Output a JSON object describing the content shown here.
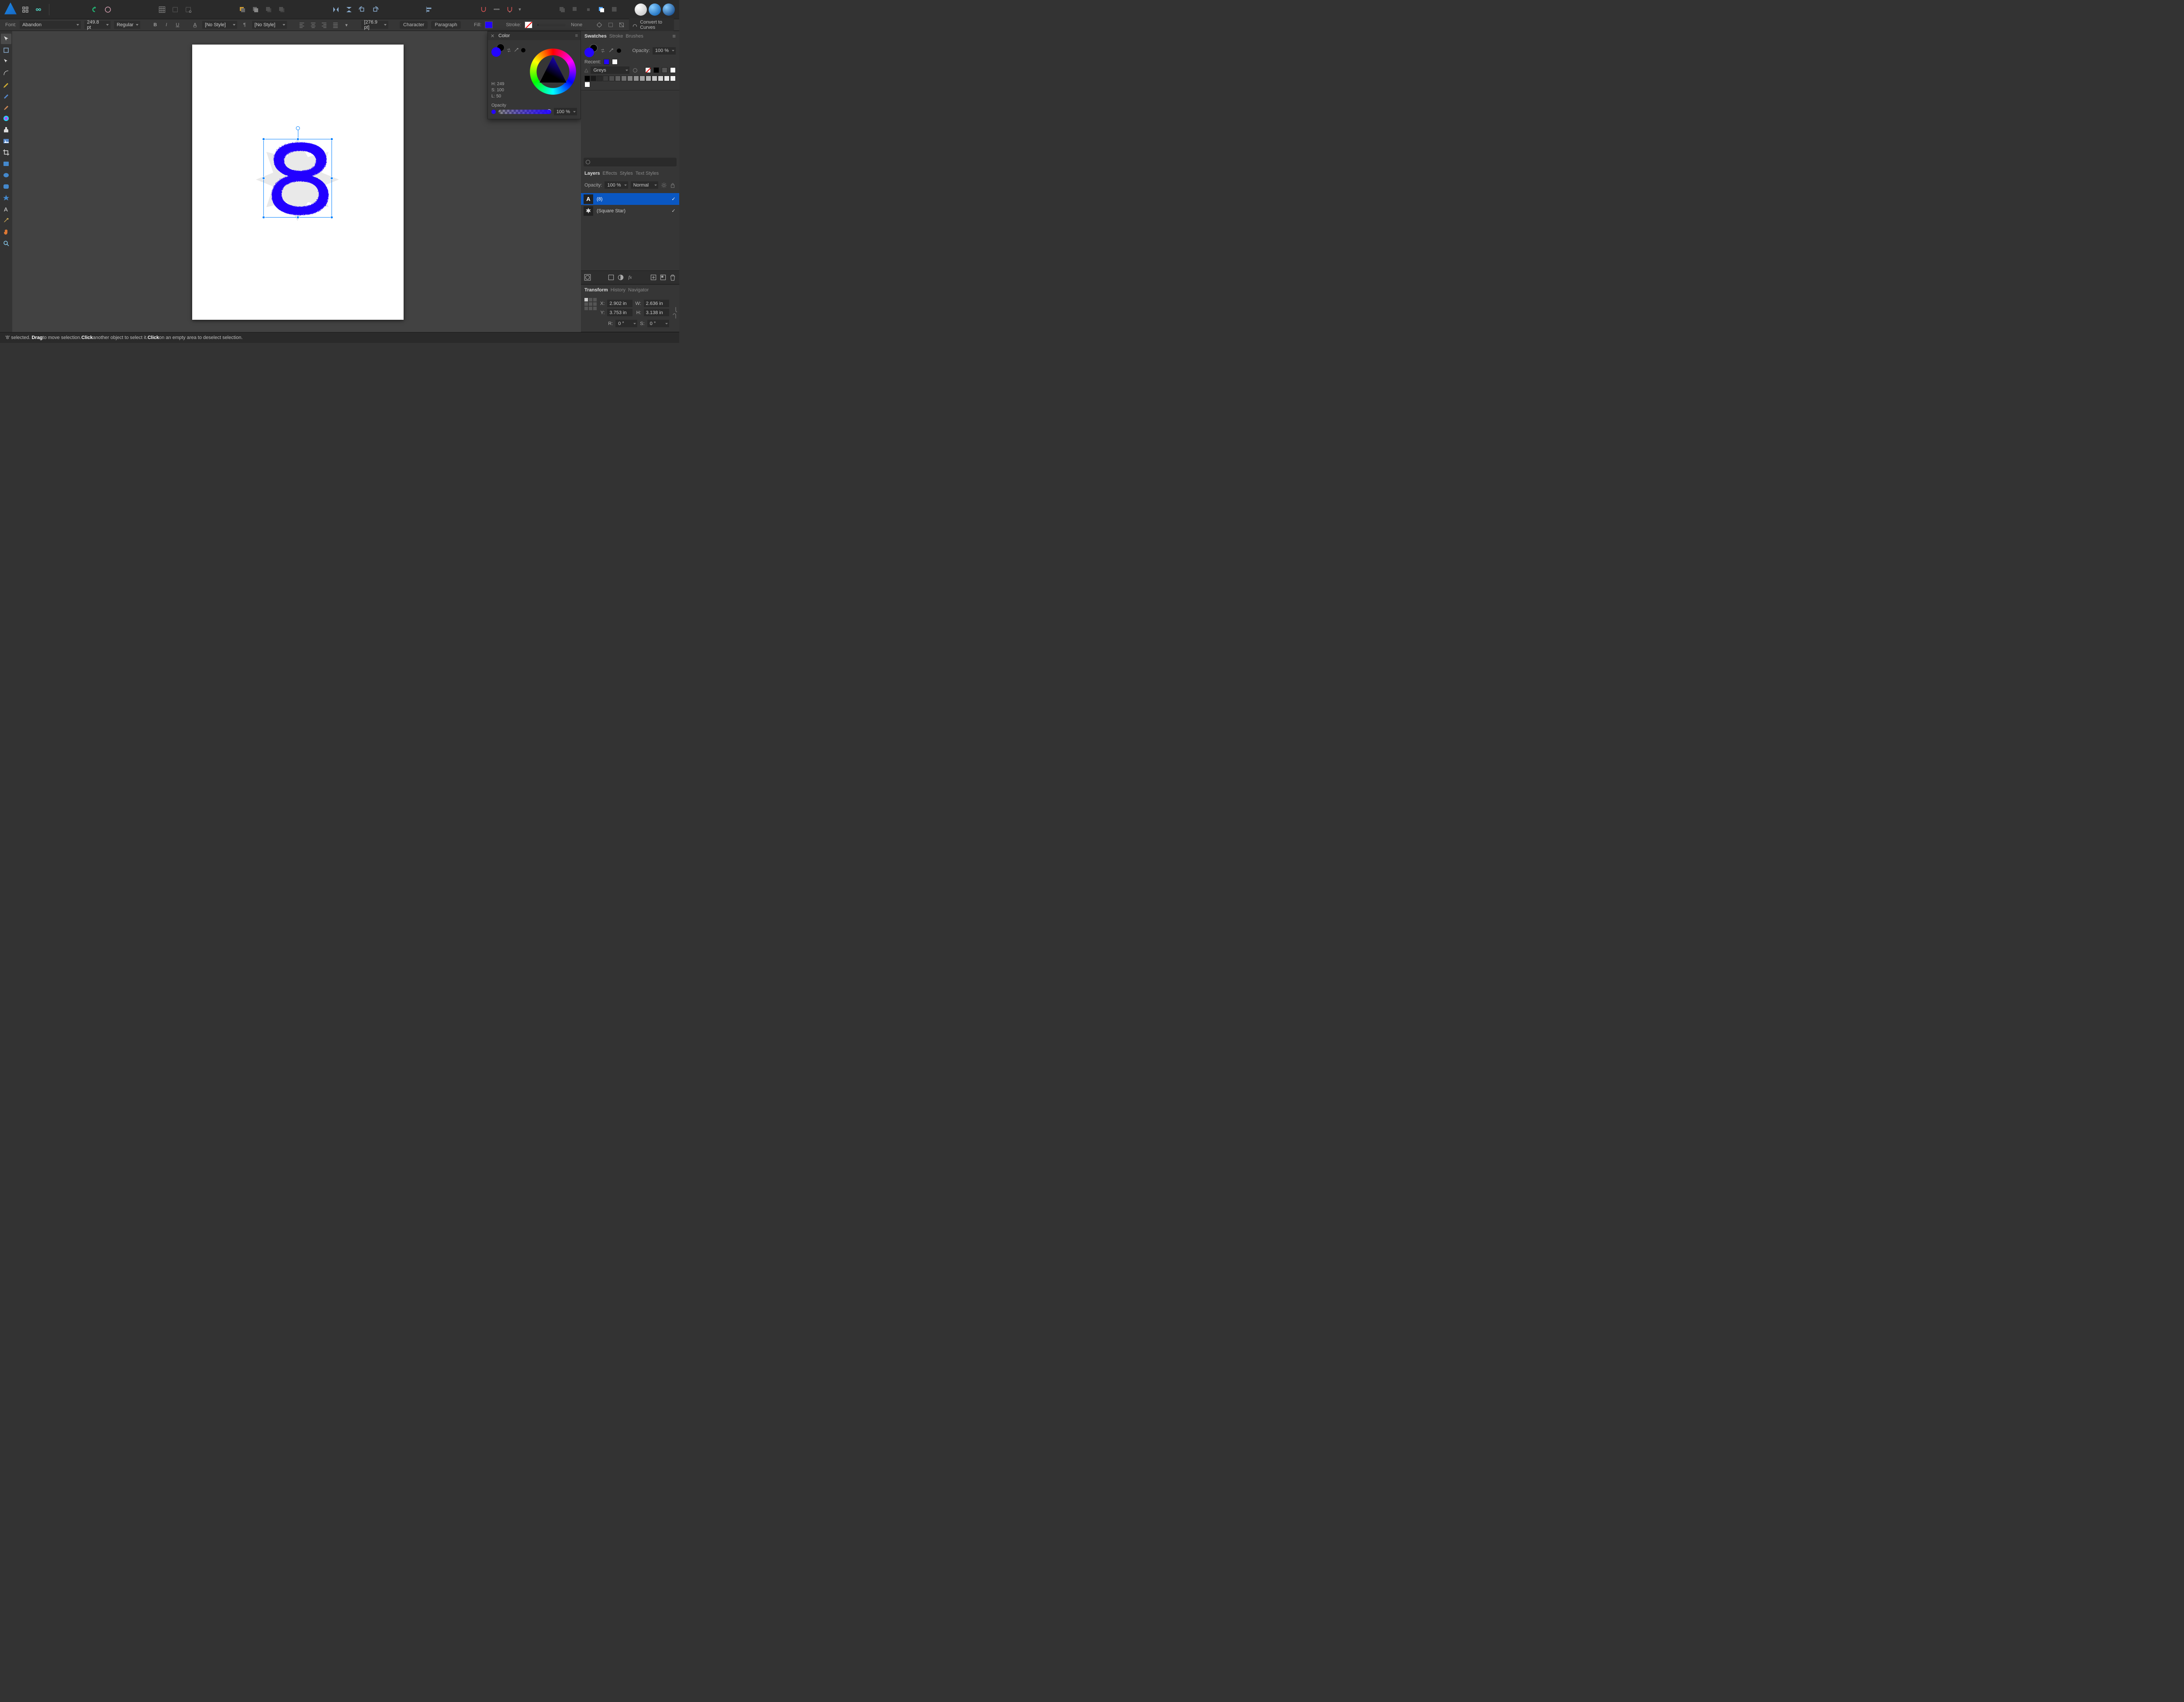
{
  "context": {
    "font_label": "Font:",
    "font_name": "Abandon",
    "font_size": "249.8 pt",
    "weight": "Regular",
    "bold": "B",
    "italic": "I",
    "underline": "U",
    "char_style": "[No Style]",
    "para_style": "[No Style]",
    "leading": "[276.9 pt]",
    "char_btn": "Character",
    "para_btn": "Paragraph",
    "fill_label": "Fill:",
    "stroke_label": "Stroke:",
    "stroke_val": "None",
    "convert": "Convert to Curves"
  },
  "status": {
    "selected": "'8' selected.",
    "drag": "Drag",
    "drag_txt": " to move selection. ",
    "click1": "Click",
    "click1_txt": " another object to select it. ",
    "click2": "Click",
    "click2_txt": " on an empty area to deselect selection."
  },
  "swatches": {
    "tabs": [
      "Swatches",
      "Stroke",
      "Brushes"
    ],
    "opacity_label": "Opacity:",
    "opacity_val": "100 %",
    "recent": "Recent:",
    "palette": "Greys",
    "greys": [
      "#000000",
      "#1a1a1a",
      "#2b2b2b",
      "#3c3c3c",
      "#4d4d4d",
      "#5e5e5e",
      "#6f6f6f",
      "#808080",
      "#919191",
      "#a2a2a2",
      "#b3b3b3",
      "#c4c4c4",
      "#d5d5d5",
      "#e6e6e6",
      "#f2f2f2",
      "#ffffff"
    ]
  },
  "color_panel": {
    "title": "Color",
    "h": "H: 249",
    "s": "S: 100",
    "l": "L: 50",
    "opacity_label": "Opacity",
    "opacity_val": "100 %"
  },
  "layers": {
    "tabs": [
      "Layers",
      "Effects",
      "Styles",
      "Text Styles"
    ],
    "opacity_label": "Opacity:",
    "opacity_val": "100 %",
    "blend": "Normal",
    "items": [
      {
        "name": "(8)",
        "sel": true,
        "type": "A"
      },
      {
        "name": "(Square Star)",
        "sel": false,
        "type": "star"
      }
    ]
  },
  "transform": {
    "tabs": [
      "Transform",
      "History",
      "Navigator"
    ],
    "x_lbl": "X:",
    "x": "2.902 in",
    "y_lbl": "Y:",
    "y": "3.753 in",
    "w_lbl": "W:",
    "w": "2.636 in",
    "h_lbl": "H:",
    "h": "3.138 in",
    "r_lbl": "R:",
    "r": "0 °",
    "s_lbl": "S:",
    "s": "0 °"
  },
  "canvas": {
    "text_char": "8"
  }
}
